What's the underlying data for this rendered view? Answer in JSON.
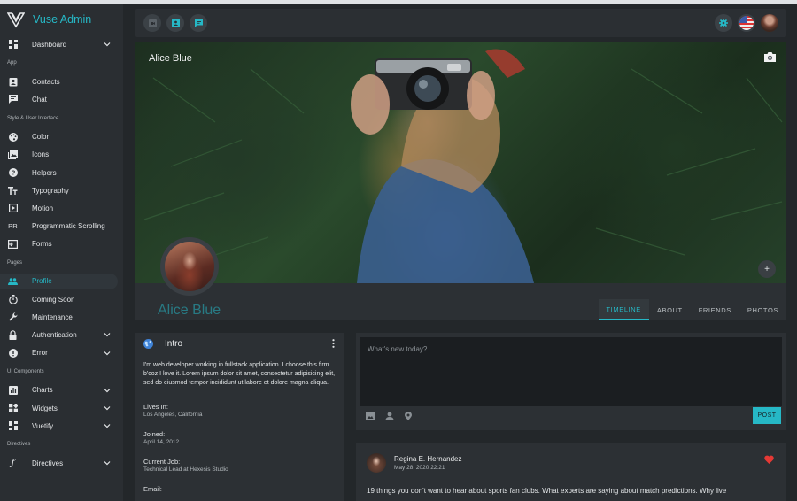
{
  "brand": {
    "title": "Vuse Admin"
  },
  "sidebar": {
    "dashboard": "Dashboard",
    "section_app": "App",
    "contacts": "Contacts",
    "chat": "Chat",
    "section_style": "Style & User Interface",
    "color": "Color",
    "icons": "Icons",
    "helpers": "Helpers",
    "typography": "Typography",
    "motion": "Motion",
    "prog_abbr": "PR",
    "prog_scrolling": "Programmatic Scrolling",
    "forms": "Forms",
    "section_pages": "Pages",
    "profile": "Profile",
    "coming_soon": "Coming Soon",
    "maintenance": "Maintenance",
    "authentication": "Authentication",
    "error": "Error",
    "section_ui": "UI Components",
    "charts": "Charts",
    "widgets": "Widgets",
    "vuetify": "Vuetify",
    "section_directives": "Directives",
    "directives": "Directives"
  },
  "cover": {
    "name": "Alice Blue"
  },
  "profile": {
    "name": "Alice Blue",
    "tabs": [
      "TIMELINE",
      "ABOUT",
      "FRIENDS",
      "PHOTOS"
    ]
  },
  "intro": {
    "title": "Intro",
    "bio": "I'm web developer working in fullstack application. I choose this firm b'coz I love it. Lorem ipsum dolor sit amet, consectetur adipisicing elit, sed do eiusmod tempor incididunt ut labore et dolore magna aliqua.",
    "lives_in_label": "Lives In:",
    "lives_in_value": "Los Angeles, California",
    "joined_label": "Joined:",
    "joined_value": "April 14, 2012",
    "job_label": "Current Job:",
    "job_value": "Technical Lead at Hexesis Studio",
    "email_label": "Email:"
  },
  "composer": {
    "placeholder": "What's new today?",
    "post_label": "POST"
  },
  "post": {
    "author": "Regina E. Hernandez",
    "date": "May 28, 2020 22:21",
    "text": "19 things you don't want to hear about sports fan clubs. What experts are saying about match predictions. Why live"
  },
  "colors": {
    "accent": "#26b8c6",
    "heart": "#e53935"
  }
}
